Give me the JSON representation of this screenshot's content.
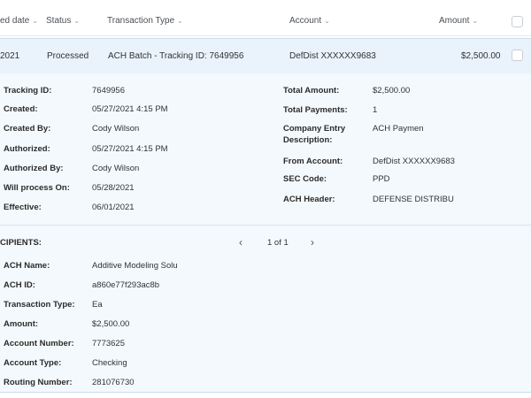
{
  "header": {
    "col_date": "ed date",
    "col_status": "Status",
    "col_type": "Transaction Type",
    "col_account": "Account",
    "col_amount": "Amount"
  },
  "row": {
    "date": "2021",
    "status": "Processed",
    "type": "ACH Batch - Tracking ID: 7649956",
    "account": "DefDist XXXXXX9683",
    "amount": "$2,500.00"
  },
  "details": {
    "left": [
      {
        "label": "Tracking ID:",
        "value": "7649956"
      },
      {
        "label": "Created:",
        "value": "05/27/2021 4:15 PM"
      },
      {
        "label": "Created By:",
        "value": "Cody Wilson"
      },
      {
        "label": "Authorized:",
        "value": "05/27/2021 4:15 PM"
      },
      {
        "label": "Authorized By:",
        "value": "Cody Wilson"
      },
      {
        "label": "Will process On:",
        "value": "05/28/2021"
      },
      {
        "label": "Effective:",
        "value": "06/01/2021"
      }
    ],
    "right": [
      {
        "label": "Total Amount:",
        "value": "$2,500.00"
      },
      {
        "label": "Total Payments:",
        "value": "1"
      },
      {
        "label": "Company Entry",
        "label2": "Description:",
        "value": "ACH Paymen"
      },
      {
        "label": "From Account:",
        "value": "DefDist XXXXXX9683"
      },
      {
        "label": "SEC Code:",
        "value": "PPD"
      },
      {
        "label": "ACH Header:",
        "value": "DEFENSE DISTRIBU"
      }
    ]
  },
  "recipients": {
    "title": "CIPIENTS:",
    "pager": {
      "prev": "‹",
      "text": "1 of 1",
      "next": "›"
    },
    "fields": [
      {
        "label": "ACH Name:",
        "value": "Additive Modeling Solu"
      },
      {
        "label": "ACH ID:",
        "value": "a860e77f293ac8b"
      },
      {
        "label": "Transaction Type:",
        "value": "Ea"
      },
      {
        "label": "Amount:",
        "value": "$2,500.00"
      },
      {
        "label": "Account Number:",
        "value": "7773625"
      },
      {
        "label": "Account Type:",
        "value": "Checking"
      },
      {
        "label": "Routing Number:",
        "value": "281076730"
      }
    ]
  }
}
